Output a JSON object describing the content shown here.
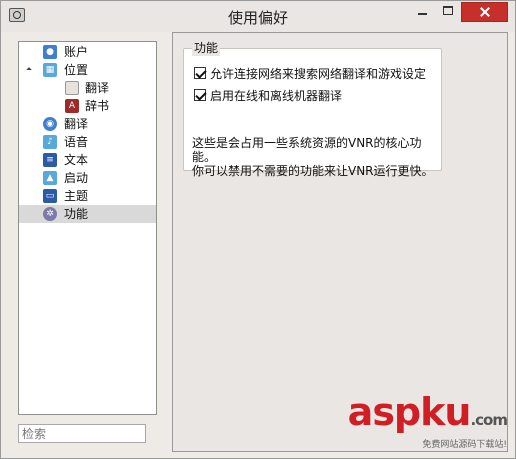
{
  "window": {
    "title": "使用偏好"
  },
  "sidebar": {
    "items": [
      {
        "label": "账户",
        "icon": "person-icon"
      },
      {
        "label": "位置",
        "icon": "folder-icon"
      },
      {
        "label": "翻译",
        "icon": "note-icon"
      },
      {
        "label": "辞书",
        "icon": "book-icon"
      },
      {
        "label": "翻译",
        "icon": "globe-icon"
      },
      {
        "label": "语音",
        "icon": "music-note-icon"
      },
      {
        "label": "文本",
        "icon": "text-icon"
      },
      {
        "label": "启动",
        "icon": "rocket-icon"
      },
      {
        "label": "主题",
        "icon": "theme-icon"
      },
      {
        "label": "功能",
        "icon": "gear-icon"
      }
    ],
    "selected": "功能"
  },
  "search": {
    "placeholder": "检索"
  },
  "panel": {
    "group_title": "功能",
    "options": [
      {
        "label": "允许连接网络来搜索网络翻译和游戏设定",
        "checked": true
      },
      {
        "label": "启用在线和离线机器翻译",
        "checked": true
      }
    ],
    "description_line1": "这些是会占用一些系统资源的VNR的核心功",
    "description_line2": "能。",
    "description_line3": "你可以禁用不需要的功能来让VNR运行更快。"
  },
  "watermark": {
    "brand_a": "asp",
    "brand_b": "ku",
    "domain": ".com",
    "tagline": "免费网站源码下载站!"
  },
  "colors": {
    "selected_row": "#d9d9d9",
    "close_button": "#c7302a",
    "watermark_red": "#d01f24"
  }
}
